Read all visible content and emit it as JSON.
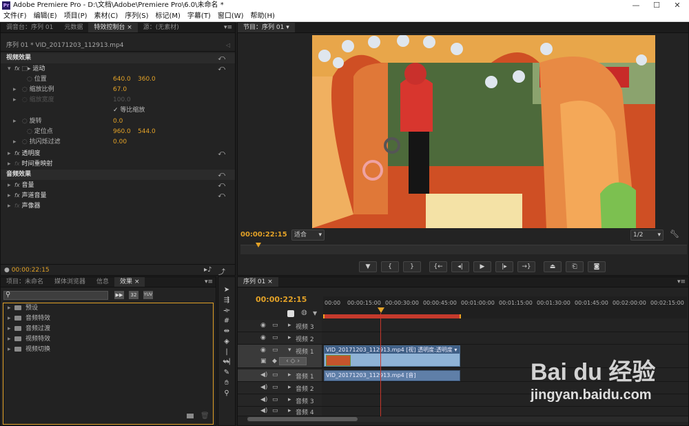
{
  "titlebar": {
    "app_icon": "Pr",
    "title": "Adobe Premiere Pro - D:\\文档\\Adobe\\Premiere Pro\\6.0\\未命名 *",
    "minimize": "—",
    "maximize": "☐",
    "close": "✕"
  },
  "menu": [
    "文件(F)",
    "编辑(E)",
    "项目(P)",
    "素材(C)",
    "序列(S)",
    "标记(M)",
    "字幕(T)",
    "窗口(W)",
    "帮助(H)"
  ],
  "effect_controls": {
    "tabs": [
      "调音台：序列 01",
      "元数据",
      "特效控制台",
      "源：(无素材)"
    ],
    "active_tab": "特效控制台",
    "tab_close": "×",
    "sequence_label": "序列 01 * VID_20171203_112913.mp4",
    "video_effects": "视频效果",
    "motion": "运动",
    "position": {
      "label": "位置",
      "x": "640.0",
      "y": "360.0"
    },
    "scale": {
      "label": "缩放比例",
      "value": "67.0"
    },
    "scale_width": {
      "label": "缩放宽度",
      "value": "100.0"
    },
    "uniform_scale": "等比缩放",
    "rotation": {
      "label": "旋转",
      "value": "0.0"
    },
    "anchor": {
      "label": "定位点",
      "x": "960.0",
      "y": "544.0"
    },
    "anti_flicker": {
      "label": "抗闪烁过滤",
      "value": "0.00"
    },
    "opacity": "透明度",
    "time_remap": "时间重映射",
    "audio_effects": "音频效果",
    "volume": "音量",
    "channel_volume": "声道音量",
    "panner": "声像器",
    "fx": "fx",
    "timecode": "00:00:22:15"
  },
  "program": {
    "tab": "节目：序列 01",
    "timecode": "00:00:22:15",
    "fit": "适合",
    "resolution": "1/2"
  },
  "project": {
    "tabs": [
      "项目：未命名",
      "媒体浏览器",
      "信息",
      "效果"
    ],
    "active_tab": "效果",
    "tab_close": "×",
    "search_placeholder": "",
    "badges": [
      "32",
      "YUV"
    ],
    "items": [
      "预设",
      "音频特效",
      "音频过渡",
      "视频特效",
      "视频切换"
    ]
  },
  "timeline": {
    "tab": "序列 01",
    "timecode": "00:00:22:15",
    "ticks": [
      "00:00",
      "00:00:15:00",
      "00:00:30:00",
      "00:00:45:00",
      "00:01:00:00",
      "00:01:15:00",
      "00:01:30:00",
      "00:01:45:00",
      "00:02:00:00",
      "00:02:15:00"
    ],
    "tracks": {
      "v3": "视频 3",
      "v2": "视频 2",
      "v1": "视频 1",
      "a1": "音频 1",
      "a2": "音频 2",
      "a3": "音频 3",
      "a4": "音频 4"
    },
    "video_clip": "VID_20171203_112913.mp4 [视] 透明度:透明度 ▾",
    "audio_clip": "VID_20171203_112913.mp4 [音]"
  },
  "watermark": {
    "brand": "Bai du 经验",
    "url": "jingyan.baidu.com"
  },
  "colors": {
    "accent": "#e3a227",
    "playhead": "#c8372b",
    "video_clip": "#8fb3d6",
    "audio_clip": "#5f7fa8"
  }
}
